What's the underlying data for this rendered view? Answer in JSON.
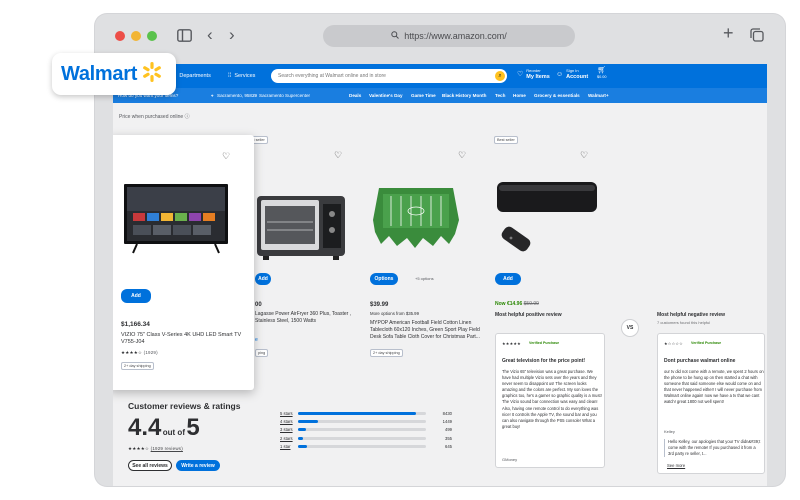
{
  "browser": {
    "url": "https://www.amazon.com/"
  },
  "logo": {
    "wordmark": "Walmart",
    "brand_color": "#0071dc",
    "spark_color": "#ffc220"
  },
  "header": {
    "departments": "Departments",
    "services": "Services",
    "search_placeholder": "Search everything at Walmart online and in store",
    "reorder_top": "Reorder",
    "reorder_bottom": "My Items",
    "signin_top": "Sign In",
    "signin_bottom": "Account",
    "cart_count": "0",
    "cart_amount": "$0.00"
  },
  "subnav": {
    "delivery": "How do you want your items?",
    "zip": "Sacramento, 95829",
    "store": "Sacramento Supercenter",
    "links": [
      "Deals",
      "Valentine's Day",
      "Game Time",
      "Black History Month",
      "Tech",
      "Home",
      "Grocery & essentials",
      "Walmart+"
    ]
  },
  "price_note": "Price when purchased online",
  "products": [
    {
      "price": "$1,166.34",
      "title": "VIZIO 75\" Class V-Series 4K UHD LED Smart TV V755-J04",
      "rating_count": "(1929)",
      "shipping": "2+ day shipping",
      "add": "Add"
    },
    {
      "badge": "Best seller",
      "price": "00",
      "title": "Lagasse Power AirFryer 360 Plus, Toaster , Stainless Steel, 1500 Watts",
      "more": "e",
      "shipping": "ping",
      "add": "Add"
    },
    {
      "price": "$39.99",
      "more": "More options from $35.99",
      "title": "MYPOP American Football Field Cotton Linen Tablecloth 60x120 Inches, Green Sport Play Field Desk Sofa Table Cloth Cover for Christmas Part...",
      "shipping": "2+ day shipping",
      "options": "Options",
      "options_count": "+5 options"
    },
    {
      "badge": "Best seller",
      "now_price": "Now €14.96",
      "was_price": "$59.99",
      "add": "Add"
    }
  ],
  "reviews": {
    "heading": "Customer reviews & ratings",
    "average": "4.4",
    "out_of": "out of",
    "max": "5",
    "count_link": "(1929 reviews)",
    "see_all": "See all reviews",
    "write": "Write a review",
    "dist": [
      {
        "label": "5 stars",
        "count": "8430",
        "fraction": 0.92
      },
      {
        "label": "4 stars",
        "count": "1449",
        "fraction": 0.16
      },
      {
        "label": "3 stars",
        "count": "499",
        "fraction": 0.06
      },
      {
        "label": "2 stars",
        "count": "355",
        "fraction": 0.04
      },
      {
        "label": "1 star",
        "count": "645",
        "fraction": 0.07
      }
    ],
    "positive": {
      "heading": "Most helpful positive review",
      "verified": "Verified Purchase",
      "title": "Great television for the price point!",
      "body": "The Vizio 65\" television was a great purchase. We have had multiple Vizio sets over the years and they never seem to disappoint us! The screen looks amazing and the colors are perfect. My son loves the graphics too, he's a gamer so graphic quality is a must! The Vizio sound bar connection was easy and clean! Also, having one remote control to do everything was nice! It controls the Apple TV, the sound bar and you can also navigate through the PS5 console! What a great buy!",
      "author": "GMoney"
    },
    "vs": "VS",
    "negative": {
      "heading": "Most helpful negative review",
      "helpful": "7 customers found this helpful",
      "verified": "Verified Purchase",
      "title": "Dont purchase walmart online",
      "body": "our tv did not come with a remote, we spent 2 hours on the phone to be hung up on then started a chat with someone that said someone else would come on and that never happened either! I will never purchase from Walmart online again! now we have a tv that we cant watch! great 1800 not well spent!",
      "author": "Kelley",
      "reply": "Hello Kelley, our apologies that your TV didn&#39;t come with the remote! If you purchased it from a 3rd party re seller, t...",
      "see_more": "See more"
    }
  }
}
